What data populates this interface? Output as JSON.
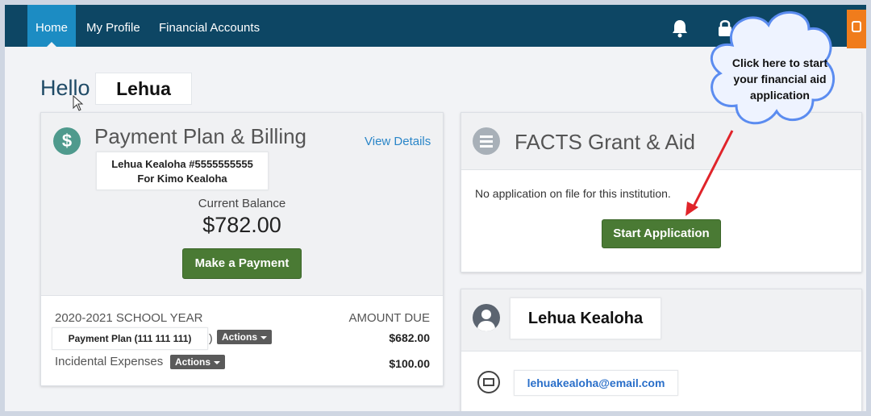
{
  "nav": {
    "tabs": [
      {
        "label": "Home",
        "active": true
      },
      {
        "label": "My Profile",
        "active": false
      },
      {
        "label": "Financial Accounts",
        "active": false
      }
    ],
    "icons": [
      "bell-icon",
      "lock-icon",
      "logout-icon"
    ],
    "colors": {
      "bar": "#0d4664",
      "active": "#1c8cc3",
      "accent": "#f07c1c"
    }
  },
  "greeting": {
    "hello": "Hello",
    "name": "Lehua"
  },
  "billing": {
    "title": "Payment Plan & Billing",
    "view_details": "View Details",
    "account_line1": "Lehua Kealoha #5555555555",
    "account_line2": "For Kimo Kealoha",
    "balance_label": "Current Balance",
    "balance_value": "$782.00",
    "pay_button": "Make a Payment",
    "year_label": "2020-2021 SCHOOL YEAR",
    "amount_due_label": "AMOUNT DUE",
    "rows": [
      {
        "label": "Payment Plan (111 111 111)",
        "suffix": ")",
        "action": "Actions",
        "amount": "$682.00"
      },
      {
        "label": "Incidental Expenses",
        "action": "Actions",
        "amount": "$100.00"
      }
    ]
  },
  "grant": {
    "title": "FACTS Grant & Aid",
    "message": "No application on file for this institution.",
    "start_button": "Start Application"
  },
  "profile": {
    "name": "Lehua Kealoha",
    "email": "lehuakealoha@email.com"
  },
  "callout": {
    "line1": "Click here to start",
    "line2": "your financial aid",
    "line3": "application"
  }
}
